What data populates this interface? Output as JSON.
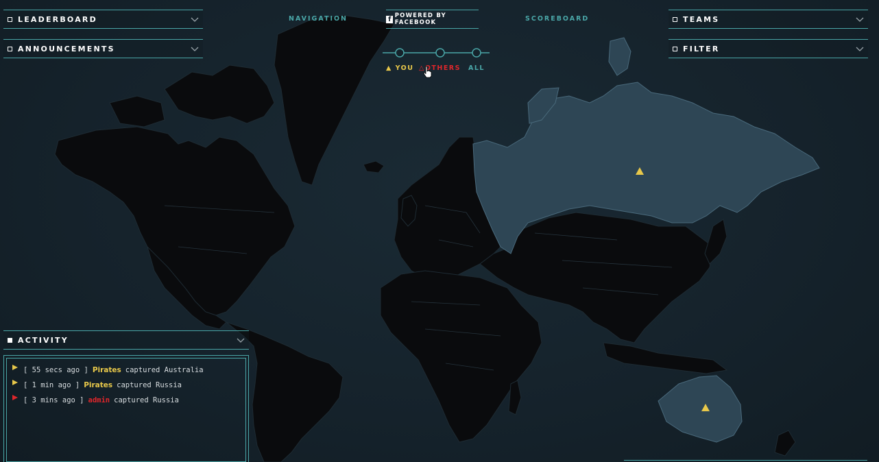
{
  "panels": {
    "leaderboard": {
      "label": "LEADERBOARD"
    },
    "announcements": {
      "label": "ANNOUNCEMENTS"
    },
    "teams": {
      "label": "TEAMS"
    },
    "filter": {
      "label": "FILTER"
    },
    "activity": {
      "label": "ACTIVITY"
    }
  },
  "nav": {
    "navigation": "NAVIGATION",
    "powered_by": "POWERED BY FACEBOOK",
    "powered_icon": "f",
    "scoreboard": "SCOREBOARD"
  },
  "view_toggle": {
    "you": "YOU",
    "others": "OTHERS",
    "all": "ALL",
    "selected": "OTHERS"
  },
  "activity": {
    "entries": [
      {
        "time": "[ 55 secs ago ]",
        "team": "Pirates",
        "action": "captured Australia",
        "team_color": "#e8c84a"
      },
      {
        "time": "[ 1 min ago ]",
        "team": "Pirates",
        "action": "captured Russia",
        "team_color": "#e8c84a"
      },
      {
        "time": "[ 3 mins ago ]",
        "team": "admin",
        "action": "captured Russia",
        "team_color": "#e0262b"
      }
    ]
  },
  "colors": {
    "accent": "#4aa7a8",
    "you": "#e8c84a",
    "others": "#e0262b",
    "background": "#15222b",
    "land": "#0a0b0d",
    "captured_land": "#2e4655"
  },
  "icons": {
    "panel_toggle": "square-icon",
    "expand": "chevron-down-icon",
    "facebook": "facebook-icon",
    "marker": "triangle-icon",
    "cursor": "hand-cursor-icon"
  }
}
